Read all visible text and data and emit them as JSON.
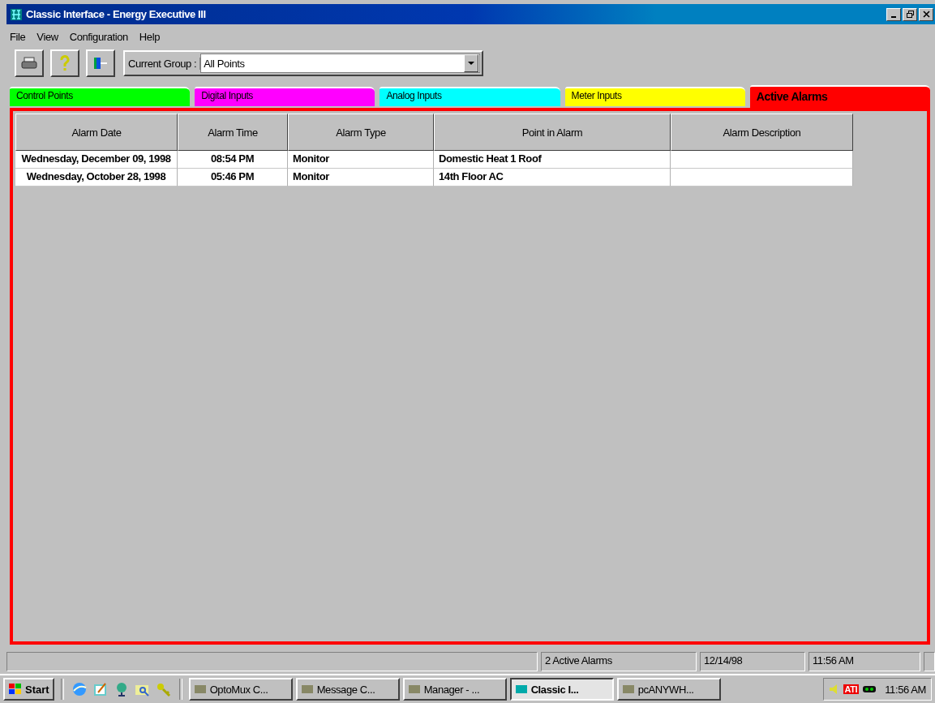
{
  "window": {
    "title": "Classic Interface - Energy Executive III"
  },
  "menu": [
    "File",
    "View",
    "Configuration",
    "Help"
  ],
  "toolbar": {
    "group_label": "Current Group :",
    "group_value": "All Points"
  },
  "tabs": [
    {
      "label": "Control Points",
      "color": "#00ff00",
      "selected": false
    },
    {
      "label": "Digital Inputs",
      "color": "#ff00ff",
      "selected": false
    },
    {
      "label": "Analog Inputs",
      "color": "#00ffff",
      "selected": false
    },
    {
      "label": "Meter Inputs",
      "color": "#ffff00",
      "selected": false
    },
    {
      "label": "Active Alarms",
      "color": "#ff0000",
      "selected": true
    }
  ],
  "table": {
    "columns": [
      "Alarm Date",
      "Alarm Time",
      "Alarm Type",
      "Point in Alarm",
      "Alarm Description"
    ],
    "rows": [
      [
        "Wednesday, December 09, 1998",
        "08:54 PM",
        "Monitor",
        "Domestic Heat 1 Roof",
        ""
      ],
      [
        "Wednesday, October 28, 1998",
        "05:46 PM",
        "Monitor",
        "14th Floor AC",
        ""
      ]
    ]
  },
  "status_bar": [
    "2 Active Alarms",
    "12/14/98",
    "11:56 AM"
  ],
  "taskbar": {
    "start": "Start",
    "tasks": [
      {
        "label": "OptoMux C...",
        "selected": false
      },
      {
        "label": "Message C...",
        "selected": false
      },
      {
        "label": "Manager - ...",
        "selected": false
      },
      {
        "label": "Classic I...",
        "selected": true
      },
      {
        "label": "pcANYWH...",
        "selected": false
      }
    ],
    "tray_logo": "ATI",
    "clock": "11:56 AM"
  }
}
